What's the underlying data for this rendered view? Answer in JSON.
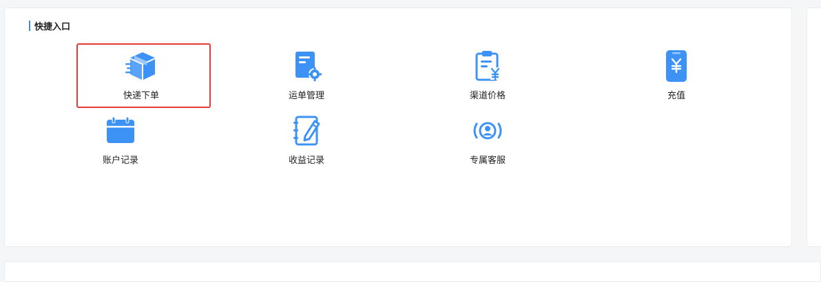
{
  "section": {
    "title": "快捷入口"
  },
  "colors": {
    "icon": "#3d93f5",
    "highlight": "#e53935",
    "accent_bar": "#3a8ee6"
  },
  "entries": [
    {
      "label": "快递下单",
      "icon": "package-icon"
    },
    {
      "label": "运单管理",
      "icon": "document-gear-icon"
    },
    {
      "label": "渠道价格",
      "icon": "clipboard-yen-icon"
    },
    {
      "label": "充值",
      "icon": "phone-yen-icon"
    },
    {
      "label": "账户记录",
      "icon": "calendar-icon"
    },
    {
      "label": "收益记录",
      "icon": "notebook-pen-icon"
    },
    {
      "label": "专属客服",
      "icon": "customer-service-icon"
    }
  ]
}
